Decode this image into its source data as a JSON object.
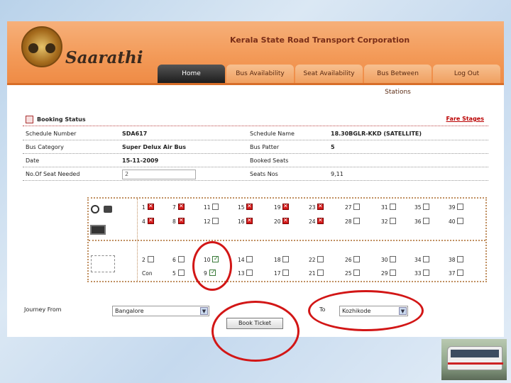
{
  "app": {
    "brand": "Saarathi",
    "corporation": "Kerala State Road Transport Corporation"
  },
  "nav": {
    "tabs": [
      {
        "label": "Home",
        "active": true
      },
      {
        "label": "Bus Availability",
        "active": false
      },
      {
        "label": "Seat Availability",
        "active": false
      },
      {
        "label": "Bus Between Stations",
        "active": false
      },
      {
        "label": "Log Out",
        "active": false
      }
    ]
  },
  "booking": {
    "title": "Booking Status",
    "fare_link": "Fare Stages",
    "schedule_number_label": "Schedule Number",
    "schedule_number": "SDA617",
    "schedule_name_label": "Schedule Name",
    "schedule_name": "18.30BGLR-KKD (SATELLITE)",
    "bus_category_label": "Bus Category",
    "bus_category": "Super Delux Air Bus",
    "bus_pattern_label": "Bus Patter",
    "bus_pattern": "5",
    "date_label": "Date",
    "date": "15-11-2009",
    "booked_seats_label": "Booked Seats",
    "booked_seats": "",
    "seats_needed_label": "No.Of Seat Needed",
    "seats_needed_value": "2",
    "seat_nos_label": "Seats Nos",
    "seat_nos_value": "9,11"
  },
  "seatmap": {
    "rows": [
      [
        {
          "n": "1",
          "s": "booked"
        },
        {
          "n": "7",
          "s": "booked"
        },
        {
          "n": "11",
          "s": "free"
        },
        {
          "n": "15",
          "s": "booked"
        },
        {
          "n": "19",
          "s": "booked"
        },
        {
          "n": "23",
          "s": "booked"
        },
        {
          "n": "27",
          "s": "free"
        },
        {
          "n": "31",
          "s": "free"
        },
        {
          "n": "35",
          "s": "free"
        },
        {
          "n": "39",
          "s": "free"
        }
      ],
      [
        {
          "n": "4",
          "s": "booked"
        },
        {
          "n": "8",
          "s": "booked"
        },
        {
          "n": "12",
          "s": "free"
        },
        {
          "n": "16",
          "s": "booked"
        },
        {
          "n": "20",
          "s": "booked"
        },
        {
          "n": "24",
          "s": "booked"
        },
        {
          "n": "28",
          "s": "free"
        },
        {
          "n": "32",
          "s": "free"
        },
        {
          "n": "36",
          "s": "free"
        },
        {
          "n": "40",
          "s": "free"
        }
      ],
      [
        {
          "n": "2",
          "s": "free"
        },
        {
          "n": "6",
          "s": "free"
        },
        {
          "n": "10",
          "s": "checked"
        },
        {
          "n": "14",
          "s": "free"
        },
        {
          "n": "18",
          "s": "free"
        },
        {
          "n": "22",
          "s": "free"
        },
        {
          "n": "26",
          "s": "free"
        },
        {
          "n": "30",
          "s": "free"
        },
        {
          "n": "34",
          "s": "free"
        },
        {
          "n": "38",
          "s": "free"
        }
      ],
      [
        {
          "n": "Con",
          "s": "none"
        },
        {
          "n": "5",
          "s": "free"
        },
        {
          "n": "9",
          "s": "checked"
        },
        {
          "n": "13",
          "s": "free"
        },
        {
          "n": "17",
          "s": "free"
        },
        {
          "n": "21",
          "s": "free"
        },
        {
          "n": "25",
          "s": "free"
        },
        {
          "n": "29",
          "s": "free"
        },
        {
          "n": "33",
          "s": "free"
        },
        {
          "n": "37",
          "s": "free"
        }
      ]
    ]
  },
  "journey": {
    "from_label": "Journey From",
    "from_value": "Bangalore",
    "to_label": "To",
    "to_value": "Kozhikode",
    "book_button": "Book Ticket"
  },
  "colors": {
    "header_orange": "#f39a58",
    "active_tab": "#1d1d1d",
    "annotation_red": "#d21616",
    "booked_seat": "#d41919"
  }
}
